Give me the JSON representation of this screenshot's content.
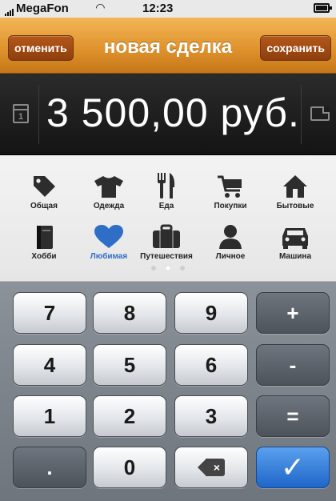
{
  "status_bar": {
    "carrier": "MegaFon",
    "time": "12:23",
    "signal_icon": "signal-bars-icon",
    "wifi_icon": "wifi-icon",
    "battery_icon": "battery-icon"
  },
  "nav": {
    "cancel_label": "отменить",
    "title": "новая сделка",
    "save_label": "сохранить",
    "bar_color": "#e0942e"
  },
  "display": {
    "calendar_day": "1",
    "amount": "3 500,00 руб.",
    "calendar_icon": "calendar-icon",
    "note_icon": "note-icon"
  },
  "categories": {
    "selected": "Любимая",
    "selected_color": "#2f6ec7",
    "items": [
      {
        "label": "Общая",
        "icon": "tag-icon"
      },
      {
        "label": "Одежда",
        "icon": "tshirt-icon"
      },
      {
        "label": "Еда",
        "icon": "fork-knife-icon"
      },
      {
        "label": "Покупки",
        "icon": "cart-icon"
      },
      {
        "label": "Бытовые",
        "icon": "house-icon"
      },
      {
        "label": "Хобби",
        "icon": "book-icon"
      },
      {
        "label": "Любимая",
        "icon": "heart-icon"
      },
      {
        "label": "Путешествия",
        "icon": "suitcase-icon"
      },
      {
        "label": "Личное",
        "icon": "person-icon"
      },
      {
        "label": "Машина",
        "icon": "car-icon"
      }
    ],
    "page_count": 3,
    "current_page": 2
  },
  "keypad": {
    "keys": [
      "7",
      "8",
      "9",
      "+",
      "4",
      "5",
      "6",
      "-",
      "1",
      "2",
      "3",
      "=",
      ".",
      "0"
    ],
    "backspace_symbol": "×",
    "confirm_symbol": "✓",
    "confirm_color": "#1f66c9"
  }
}
